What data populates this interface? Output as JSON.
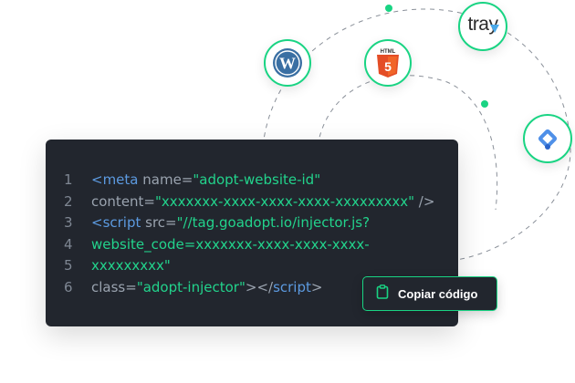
{
  "integrations": {
    "wordpress": {
      "name": "wordpress-icon"
    },
    "html5": {
      "name": "html5-icon",
      "badge": "HTML",
      "glyph": "5"
    },
    "tray": {
      "name": "tray-logo",
      "text": "tray"
    },
    "gtm": {
      "name": "google-tag-manager-icon"
    }
  },
  "code": {
    "lines": [
      {
        "num": "1",
        "parts": [
          {
            "t": "tag",
            "v": "<meta"
          },
          {
            "t": "attr",
            "v": " name="
          },
          {
            "t": "str",
            "v": "\"adopt-website-id\""
          }
        ]
      },
      {
        "num": "2",
        "parts": [
          {
            "t": "attr",
            "v": "content="
          },
          {
            "t": "str",
            "v": "\"xxxxxxx-xxxx-xxxx-xxxx-xxxxxxxxx\""
          },
          {
            "t": "punct",
            "v": " />"
          }
        ]
      },
      {
        "num": "3",
        "parts": [
          {
            "t": "tag",
            "v": "<script"
          },
          {
            "t": "attr",
            "v": " src="
          },
          {
            "t": "str",
            "v": "\"//tag.goadopt.io/injector.js?"
          }
        ]
      },
      {
        "num": "4",
        "parts": [
          {
            "t": "str",
            "v": "website_code=xxxxxxx-xxxx-xxxx-xxxx-"
          }
        ]
      },
      {
        "num": "5",
        "parts": [
          {
            "t": "str",
            "v": "xxxxxxxxx\""
          }
        ]
      },
      {
        "num": "6",
        "parts": [
          {
            "t": "attr",
            "v": "class="
          },
          {
            "t": "str",
            "v": "\"adopt-injector\""
          },
          {
            "t": "punct",
            "v": "></"
          },
          {
            "t": "tag",
            "v": "script"
          },
          {
            "t": "punct",
            "v": ">"
          }
        ]
      }
    ]
  },
  "copy_button": {
    "label": "Copiar código",
    "icon": "clipboard-icon"
  },
  "colors": {
    "accent": "#19d483",
    "code_bg": "#22262e",
    "tag": "#5c9ae0",
    "string": "#22d38c",
    "attr": "#9aa3af",
    "line_number": "#7f8793"
  }
}
